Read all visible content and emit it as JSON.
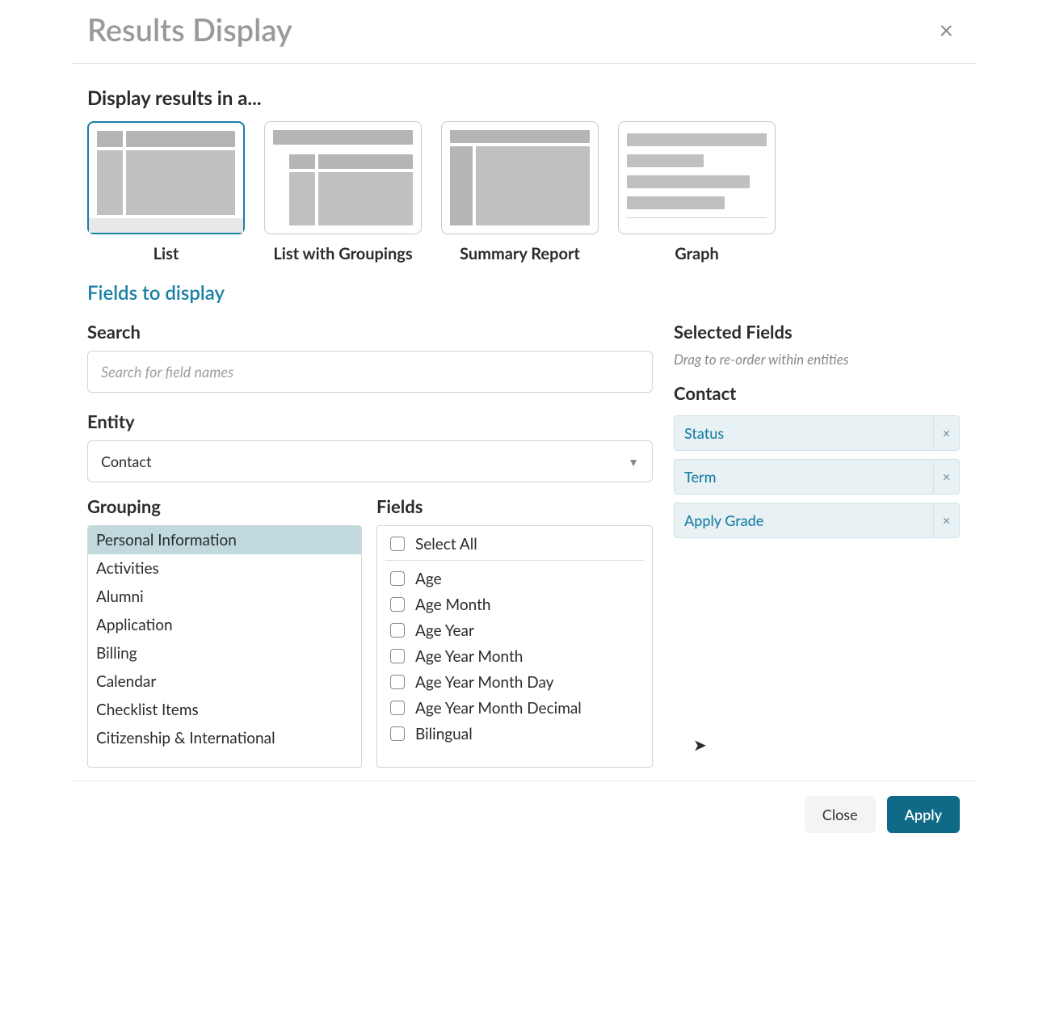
{
  "dialog": {
    "title": "Results Display"
  },
  "display_in": {
    "heading": "Display results in a...",
    "options": [
      {
        "label": "List",
        "selected": true
      },
      {
        "label": "List with Groupings",
        "selected": false
      },
      {
        "label": "Summary Report",
        "selected": false
      },
      {
        "label": "Graph",
        "selected": false
      }
    ]
  },
  "fields_section": {
    "title": "Fields to display",
    "search_label": "Search",
    "search_placeholder": "Search for field names",
    "entity_label": "Entity",
    "entity_value": "Contact",
    "grouping_label": "Grouping",
    "fields_label": "Fields",
    "groupings": [
      {
        "name": "Personal Information",
        "active": true
      },
      {
        "name": "Activities",
        "active": false
      },
      {
        "name": "Alumni",
        "active": false
      },
      {
        "name": "Application",
        "active": false
      },
      {
        "name": "Billing",
        "active": false
      },
      {
        "name": "Calendar",
        "active": false
      },
      {
        "name": "Checklist Items",
        "active": false
      },
      {
        "name": "Citizenship & International",
        "active": false
      }
    ],
    "select_all_label": "Select All",
    "fields": [
      {
        "name": "Age",
        "checked": false
      },
      {
        "name": "Age Month",
        "checked": false
      },
      {
        "name": "Age Year",
        "checked": false
      },
      {
        "name": "Age Year Month",
        "checked": false
      },
      {
        "name": "Age Year Month Day",
        "checked": false
      },
      {
        "name": "Age Year Month Decimal",
        "checked": false
      },
      {
        "name": "Bilingual",
        "checked": false
      }
    ]
  },
  "selected_fields": {
    "heading": "Selected Fields",
    "hint": "Drag to re-order within entities",
    "entity": "Contact",
    "items": [
      "Status",
      "Term",
      "Apply Grade"
    ]
  },
  "footer": {
    "close": "Close",
    "apply": "Apply"
  }
}
